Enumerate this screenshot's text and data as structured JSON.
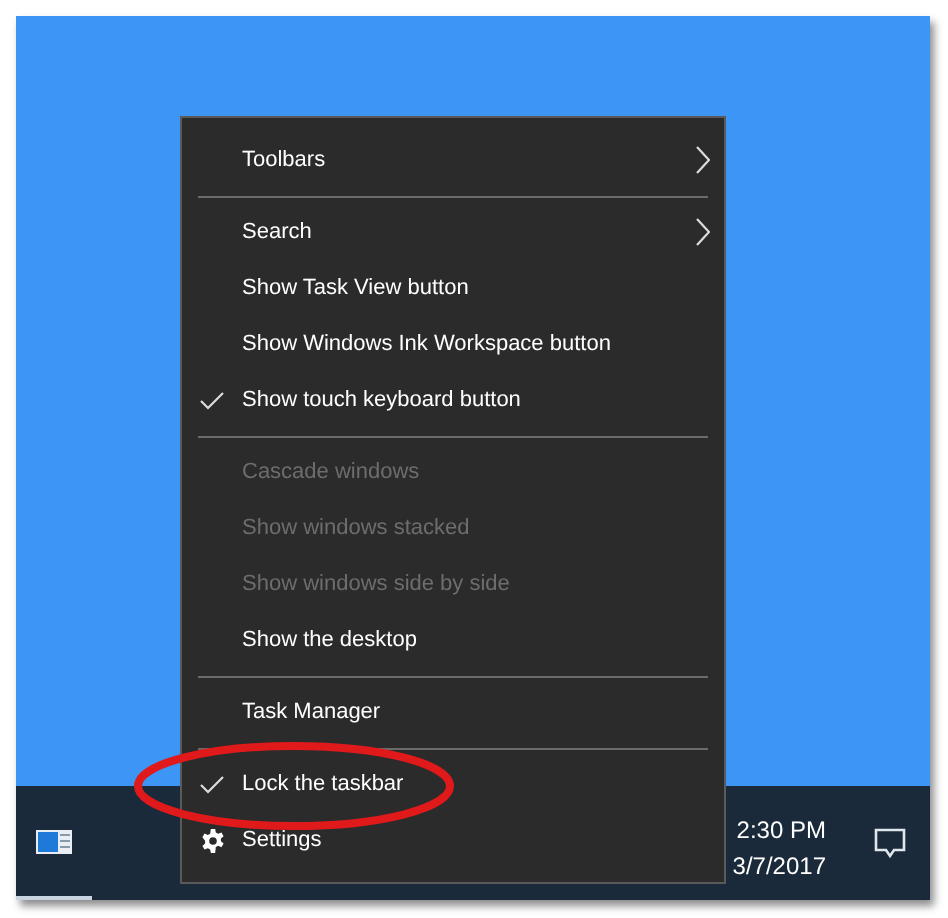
{
  "menu": {
    "items": [
      {
        "kind": "item",
        "label": "Toolbars",
        "checked": false,
        "disabled": false,
        "submenu": true
      },
      {
        "kind": "separator"
      },
      {
        "kind": "item",
        "label": "Search",
        "checked": false,
        "disabled": false,
        "submenu": true
      },
      {
        "kind": "item",
        "label": "Show Task View button",
        "checked": false,
        "disabled": false,
        "submenu": false
      },
      {
        "kind": "item",
        "label": "Show Windows Ink Workspace button",
        "checked": false,
        "disabled": false,
        "submenu": false
      },
      {
        "kind": "item",
        "label": "Show touch keyboard button",
        "checked": true,
        "disabled": false,
        "submenu": false
      },
      {
        "kind": "separator"
      },
      {
        "kind": "item",
        "label": "Cascade windows",
        "checked": false,
        "disabled": true,
        "submenu": false
      },
      {
        "kind": "item",
        "label": "Show windows stacked",
        "checked": false,
        "disabled": true,
        "submenu": false
      },
      {
        "kind": "item",
        "label": "Show windows side by side",
        "checked": false,
        "disabled": true,
        "submenu": false
      },
      {
        "kind": "item",
        "label": "Show the desktop",
        "checked": false,
        "disabled": false,
        "submenu": false
      },
      {
        "kind": "separator"
      },
      {
        "kind": "item",
        "label": "Task Manager",
        "checked": false,
        "disabled": false,
        "submenu": false
      },
      {
        "kind": "separator"
      },
      {
        "kind": "item",
        "label": "Lock the taskbar",
        "checked": true,
        "disabled": false,
        "submenu": false
      },
      {
        "kind": "settings",
        "label": "Settings",
        "checked": false,
        "disabled": false,
        "submenu": false
      }
    ]
  },
  "taskbar": {
    "time": "2:30 PM",
    "date": "3/7/2017"
  }
}
